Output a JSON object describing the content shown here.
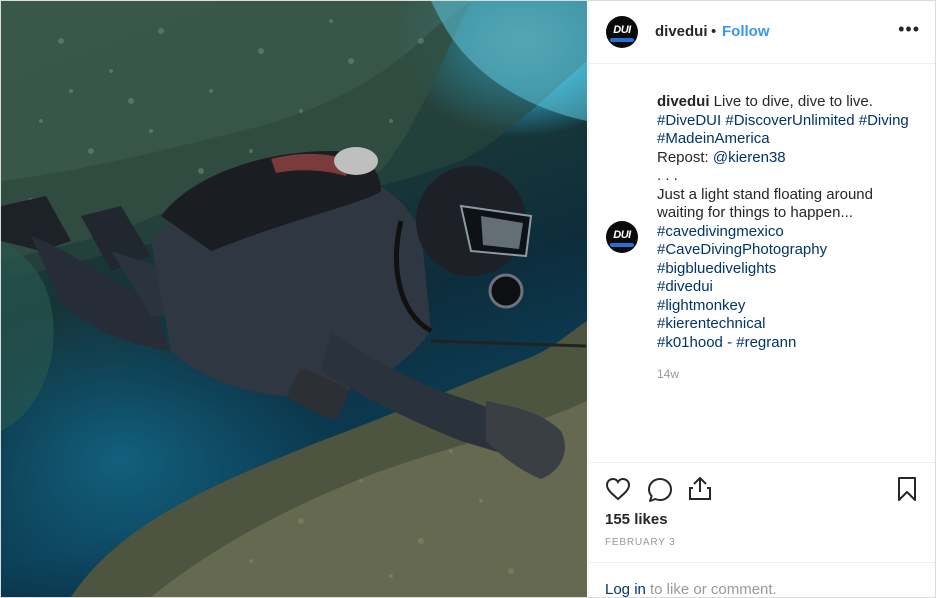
{
  "photo": {
    "icon": "diver-photo"
  },
  "header": {
    "username": "divedui",
    "separator": "•",
    "follow_label": "Follow",
    "more_label": "•••",
    "avatar_text": "DUI"
  },
  "caption": {
    "username": "divedui",
    "first_line_text": " Live to dive, dive to live.",
    "line2": "#DiveDUI #DiscoverUnlimited #Diving",
    "line3": "#MadeinAmerica",
    "repost_prefix": "Repost: ",
    "repost_handle": "@kieren38",
    "dots": ". . .",
    "body1": "Just a light stand floating around",
    "body2": "waiting for things to happen...",
    "tags": [
      "#cavedivingmexico",
      "#CaveDivingPhotography",
      "#bigbluedivelights",
      "#divedui",
      "#lightmonkey",
      "#kierentechnical"
    ],
    "last_tag": "#k01hood",
    "last_sep": " - ",
    "last_tag2": "#regrann",
    "time_ago": "14w"
  },
  "actions": {
    "likes": "155 likes",
    "date": "FEBRUARY 3",
    "login_label": "Log in",
    "login_suffix": " to like or comment."
  },
  "colors": {
    "link": "#003569",
    "follow": "#3897f0",
    "muted": "#999999",
    "text": "#262626"
  }
}
